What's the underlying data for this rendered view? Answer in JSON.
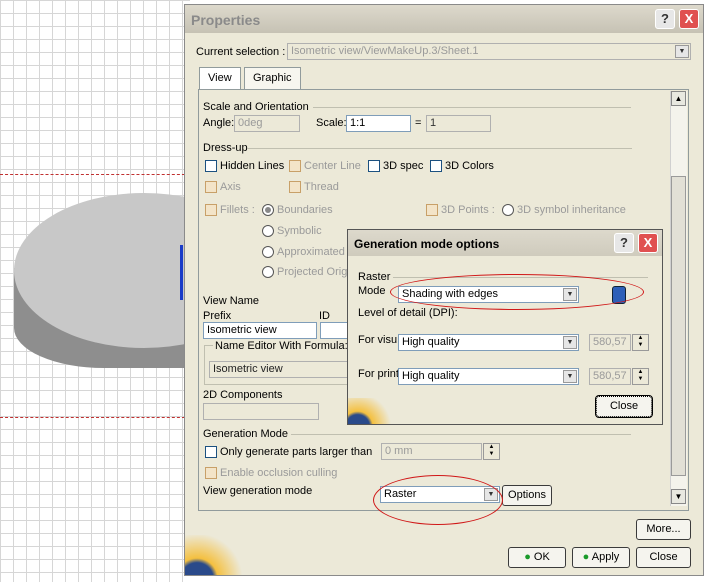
{
  "properties": {
    "title": "Properties",
    "help_label": "?",
    "close_label": "X",
    "current_selection_label": "Current selection :",
    "current_selection_value": "Isometric view/ViewMakeUp.3/Sheet.1",
    "tabs": [
      {
        "label": "View"
      },
      {
        "label": "Graphic"
      }
    ],
    "scale_section": "Scale and Orientation",
    "angle_label": "Angle:",
    "angle_value": "0deg",
    "scale_label": "Scale:",
    "scale_value": "1:1",
    "equals": "=",
    "scale_result": "1",
    "dressup_section": "Dress-up",
    "hidden_lines": "Hidden Lines",
    "center_line": "Center Line",
    "spec_3d": "3D spec",
    "colors_3d": "3D Colors",
    "axis": "Axis",
    "thread": "Thread",
    "fillets": "Fillets :",
    "boundaries": "Boundaries",
    "symbolic": "Symbolic",
    "approximated": "Approximated",
    "projected_orig": "Projected Orig",
    "points_3d": "3D Points :",
    "symbol_inheritance": "3D symbol inheritance",
    "view_name_section": "View Name",
    "prefix_label": "Prefix",
    "id_label": "ID",
    "prefix_value": "Isometric view",
    "name_editor_label": "Name Editor With Formula:",
    "name_editor_value": "Isometric view",
    "components_2d": "2D Components",
    "generation_mode_section": "Generation Mode",
    "only_generate_label": "Only generate parts larger than",
    "only_generate_value": "0 mm",
    "occlusion_label": "Enable occlusion culling",
    "view_generation_label": "View generation mode",
    "view_generation_value": "Raster",
    "options_label": "Options",
    "more_label": "More...",
    "ok_label": "OK",
    "apply_label": "Apply",
    "close_button_label": "Close"
  },
  "gen_dialog": {
    "title": "Generation mode options",
    "help_label": "?",
    "close_label": "X",
    "raster_section": "Raster",
    "mode_label": "Mode",
    "mode_value": "Shading with edges",
    "lod_label": "Level of detail (DPI):",
    "visu_label": "For visu",
    "visu_value": "High quality",
    "visu_dpi": "580,57",
    "print_label": "For print",
    "print_value": "High quality",
    "print_dpi": "580,57",
    "close_label_btn": "Close"
  },
  "colors": {
    "titlebar": "#0a246a",
    "accent": "#d01818"
  }
}
